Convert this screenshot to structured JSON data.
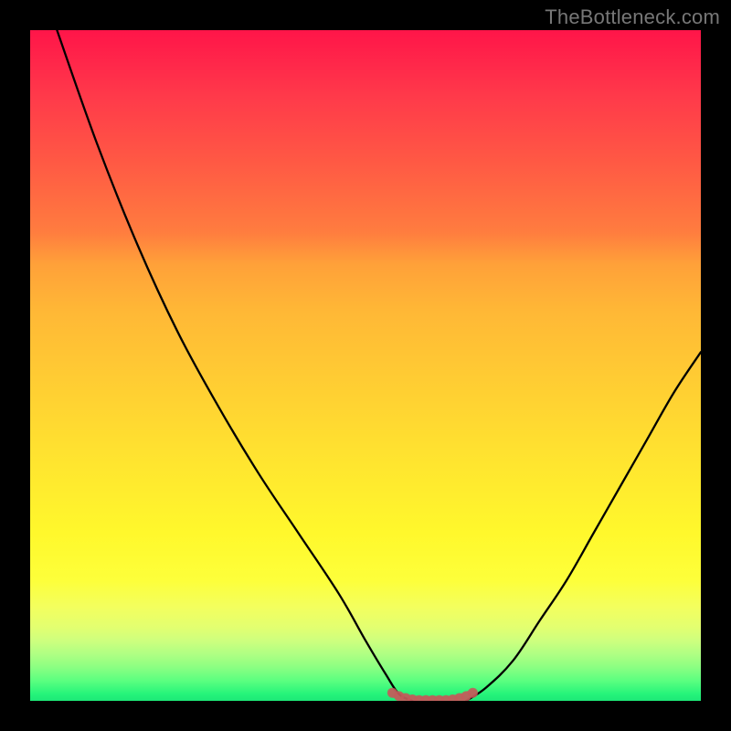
{
  "watermark": "TheBottleneck.com",
  "colors": {
    "background_frame": "#000000",
    "curve": "#000000",
    "marker": "#c35a5a",
    "gradient_top": "#ff1549",
    "gradient_bottom": "#1ee877"
  },
  "chart_data": {
    "type": "line",
    "title": "",
    "xlabel": "",
    "ylabel": "",
    "xlim": [
      0,
      100
    ],
    "ylim": [
      0,
      100
    ],
    "description": "Bottleneck heat-map. Color encodes severity top (red, high) to bottom (green, low). Two black curves fall from high x values on either side toward a shared minimum near the bottom center. A short red segment of data markers sits along the curve's minimum.",
    "series": [
      {
        "name": "left-curve",
        "description": "Falls from the top-left corner, concave-down, reaching the bottom near x≈55.",
        "x": [
          4,
          10,
          16,
          22,
          28,
          34,
          40,
          46,
          50,
          53,
          55,
          57
        ],
        "y": [
          100,
          83,
          68,
          55,
          44,
          34,
          25,
          16,
          9,
          4,
          1,
          0
        ]
      },
      {
        "name": "right-curve",
        "description": "Rises from the bottom near x≈65 up and rightward, exiting near the upper-right above mid-height.",
        "x": [
          65,
          68,
          72,
          76,
          80,
          84,
          88,
          92,
          96,
          100
        ],
        "y": [
          0,
          2,
          6,
          12,
          18,
          25,
          32,
          39,
          46,
          52
        ]
      },
      {
        "name": "minimum-markers",
        "description": "Cluster of faded red dots / strokes sitting on the valley floor between the two curves.",
        "x": [
          54,
          55,
          56,
          57,
          58,
          59,
          60,
          61,
          62,
          63,
          64,
          65,
          66
        ],
        "y": [
          1.2,
          0.7,
          0.4,
          0.2,
          0.1,
          0.1,
          0.1,
          0.1,
          0.1,
          0.2,
          0.4,
          0.7,
          1.2
        ]
      }
    ]
  }
}
